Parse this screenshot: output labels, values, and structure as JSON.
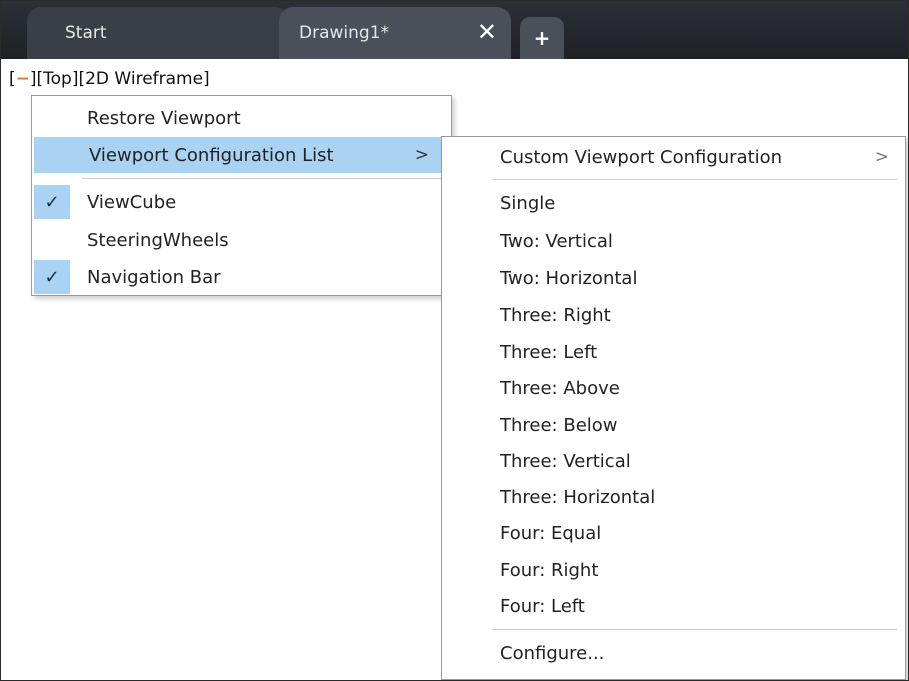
{
  "tabs": {
    "start_label": "Start",
    "drawing_label": "Drawing1*",
    "close_glyph": "✕",
    "new_glyph": "+"
  },
  "viewport_label": {
    "open": "[",
    "minus": "−",
    "rest": "][Top][2D Wireframe]"
  },
  "context_menu": {
    "restore": "Restore Viewport",
    "config_list": "Viewport Configuration List",
    "viewcube": "ViewCube",
    "viewcube_checked": true,
    "steering": "SteeringWheels",
    "navbar": "Navigation Bar",
    "navbar_checked": true,
    "submenu_arrow": ">"
  },
  "submenu": {
    "custom": "Custom Viewport Configuration",
    "custom_arrow": ">",
    "items": [
      "Single",
      "Two:  Vertical",
      "Two:  Horizontal",
      "Three: Right",
      "Three: Left",
      "Three: Above",
      "Three: Below",
      "Three: Vertical",
      "Three: Horizontal",
      "Four:  Equal",
      "Four:  Right",
      "Four:  Left"
    ],
    "configure": "Configure..."
  },
  "colors": {
    "highlight": "#a9d2f3",
    "tabbar": "#2c2f35",
    "minus_accent": "#d9822b"
  },
  "icons": {
    "check": "checkmark-icon",
    "close": "close-icon",
    "new_tab": "plus-icon",
    "submenu": "chevron-right-icon"
  }
}
